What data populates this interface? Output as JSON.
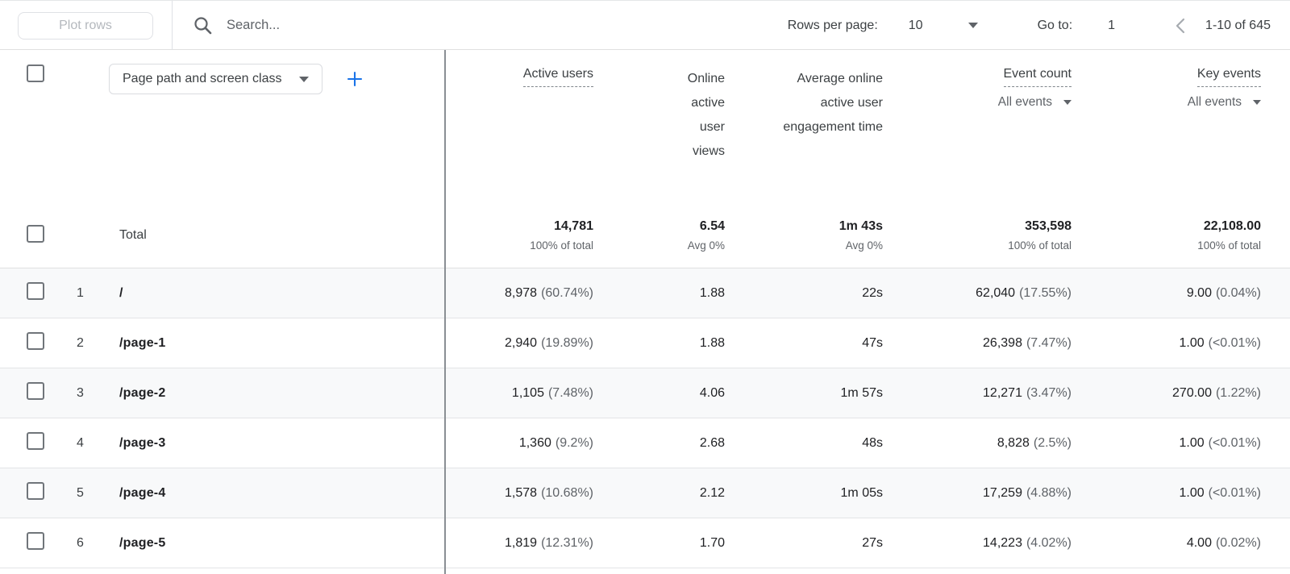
{
  "colors": {
    "accent_blue": "#1a73e8",
    "text_dark": "#202124",
    "text_gray": "#5f6368",
    "stripe": "#f8f9fa"
  },
  "toolbar": {
    "plot_rows_label": "Plot rows",
    "search_placeholder": "Search...",
    "rows_per_page_label": "Rows per page:",
    "rows_per_page_value": "10",
    "go_to_label": "Go to:",
    "go_to_value": "1",
    "pagination_range": "1-10 of 645"
  },
  "table": {
    "dimension_selector": "Page path and screen class",
    "columns": [
      {
        "label": "Active users"
      },
      {
        "label": "Online active user views"
      },
      {
        "label": "Average online active user engagement time"
      },
      {
        "label": "Event count",
        "filter": "All events"
      },
      {
        "label": "Key events",
        "filter": "All events"
      }
    ],
    "total": {
      "label": "Total",
      "metrics": [
        {
          "value": "14,781",
          "sub": "100% of total"
        },
        {
          "value": "6.54",
          "sub": "Avg 0%"
        },
        {
          "value": "1m 43s",
          "sub": "Avg 0%"
        },
        {
          "value": "353,598",
          "sub": "100% of total"
        },
        {
          "value": "22,108.00",
          "sub": "100% of total"
        }
      ]
    },
    "rows": [
      {
        "index": "1",
        "path": "/",
        "metrics": [
          {
            "value": "8,978",
            "pct": "(60.74%)"
          },
          {
            "value": "1.88",
            "pct": ""
          },
          {
            "value": "22s",
            "pct": ""
          },
          {
            "value": "62,040",
            "pct": "(17.55%)"
          },
          {
            "value": "9.00",
            "pct": "(0.04%)"
          }
        ]
      },
      {
        "index": "2",
        "path": "/page-1",
        "metrics": [
          {
            "value": "2,940",
            "pct": "(19.89%)"
          },
          {
            "value": "1.88",
            "pct": ""
          },
          {
            "value": "47s",
            "pct": ""
          },
          {
            "value": "26,398",
            "pct": "(7.47%)"
          },
          {
            "value": "1.00",
            "pct": "(<0.01%)"
          }
        ]
      },
      {
        "index": "3",
        "path": "/page-2",
        "metrics": [
          {
            "value": "1,105",
            "pct": "(7.48%)"
          },
          {
            "value": "4.06",
            "pct": ""
          },
          {
            "value": "1m 57s",
            "pct": ""
          },
          {
            "value": "12,271",
            "pct": "(3.47%)"
          },
          {
            "value": "270.00",
            "pct": "(1.22%)"
          }
        ]
      },
      {
        "index": "4",
        "path": "/page-3",
        "metrics": [
          {
            "value": "1,360",
            "pct": "(9.2%)"
          },
          {
            "value": "2.68",
            "pct": ""
          },
          {
            "value": "48s",
            "pct": ""
          },
          {
            "value": "8,828",
            "pct": "(2.5%)"
          },
          {
            "value": "1.00",
            "pct": "(<0.01%)"
          }
        ]
      },
      {
        "index": "5",
        "path": "/page-4",
        "metrics": [
          {
            "value": "1,578",
            "pct": "(10.68%)"
          },
          {
            "value": "2.12",
            "pct": ""
          },
          {
            "value": "1m 05s",
            "pct": ""
          },
          {
            "value": "17,259",
            "pct": "(4.88%)"
          },
          {
            "value": "1.00",
            "pct": "(<0.01%)"
          }
        ]
      },
      {
        "index": "6",
        "path": "/page-5",
        "metrics": [
          {
            "value": "1,819",
            "pct": "(12.31%)"
          },
          {
            "value": "1.70",
            "pct": ""
          },
          {
            "value": "27s",
            "pct": ""
          },
          {
            "value": "14,223",
            "pct": "(4.02%)"
          },
          {
            "value": "4.00",
            "pct": "(0.02%)"
          }
        ]
      }
    ]
  }
}
